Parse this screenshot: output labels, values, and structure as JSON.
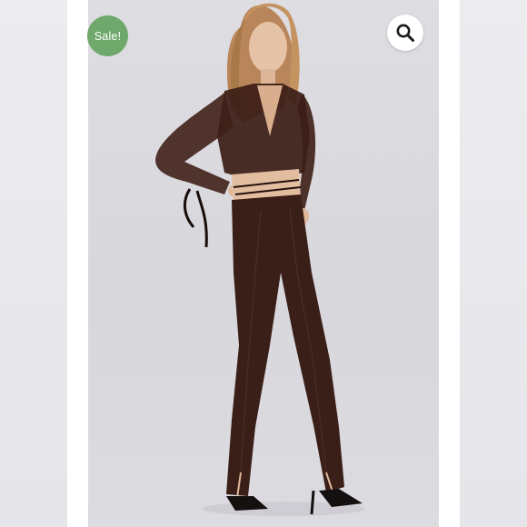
{
  "badge": {
    "label": "Sale!",
    "color": "#6ea86a"
  },
  "zoom": {
    "icon": "magnifier-icon"
  },
  "product_image": {
    "subject": "model-wearing-brown-mesh-wrap-top-and-split-hem-flare-pants",
    "background_color": "#dcdbe0",
    "garment_color": "#3a1f18"
  }
}
